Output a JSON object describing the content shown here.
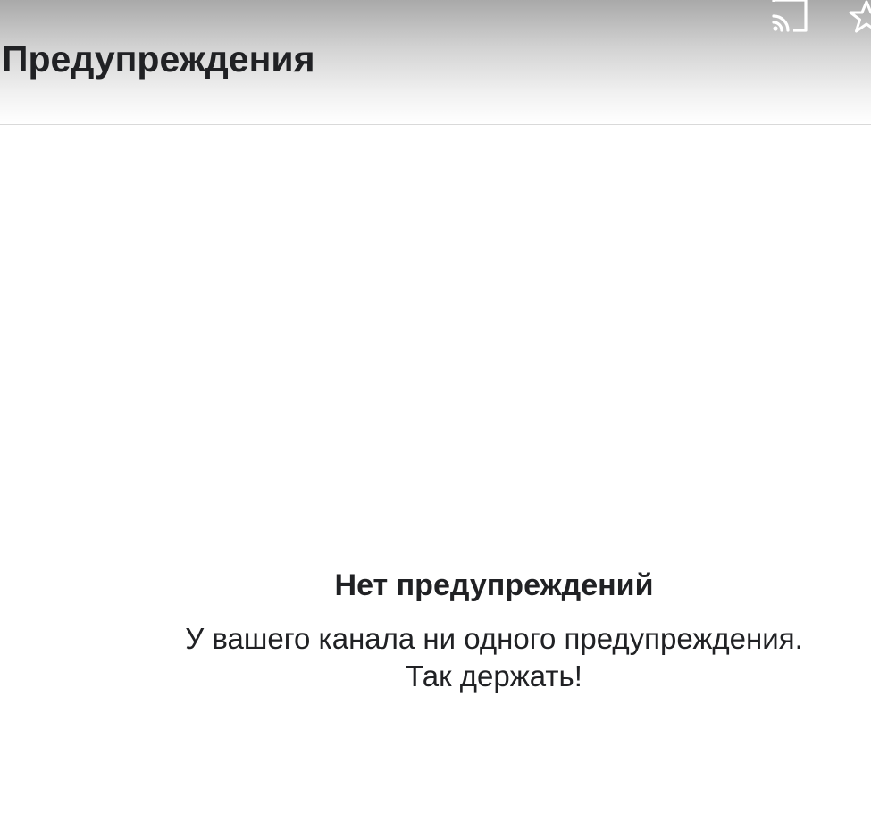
{
  "header": {
    "title": "Предупреждения",
    "cast_icon": "cast-icon",
    "star_icon": "star-icon"
  },
  "empty_state": {
    "title": "Нет предупреждений",
    "line1": "У вашего канала ни одного предупреждения.",
    "line2": "Так держать!"
  },
  "colors": {
    "text": "#202124",
    "icon": "#ffffff",
    "background": "#ffffff"
  }
}
